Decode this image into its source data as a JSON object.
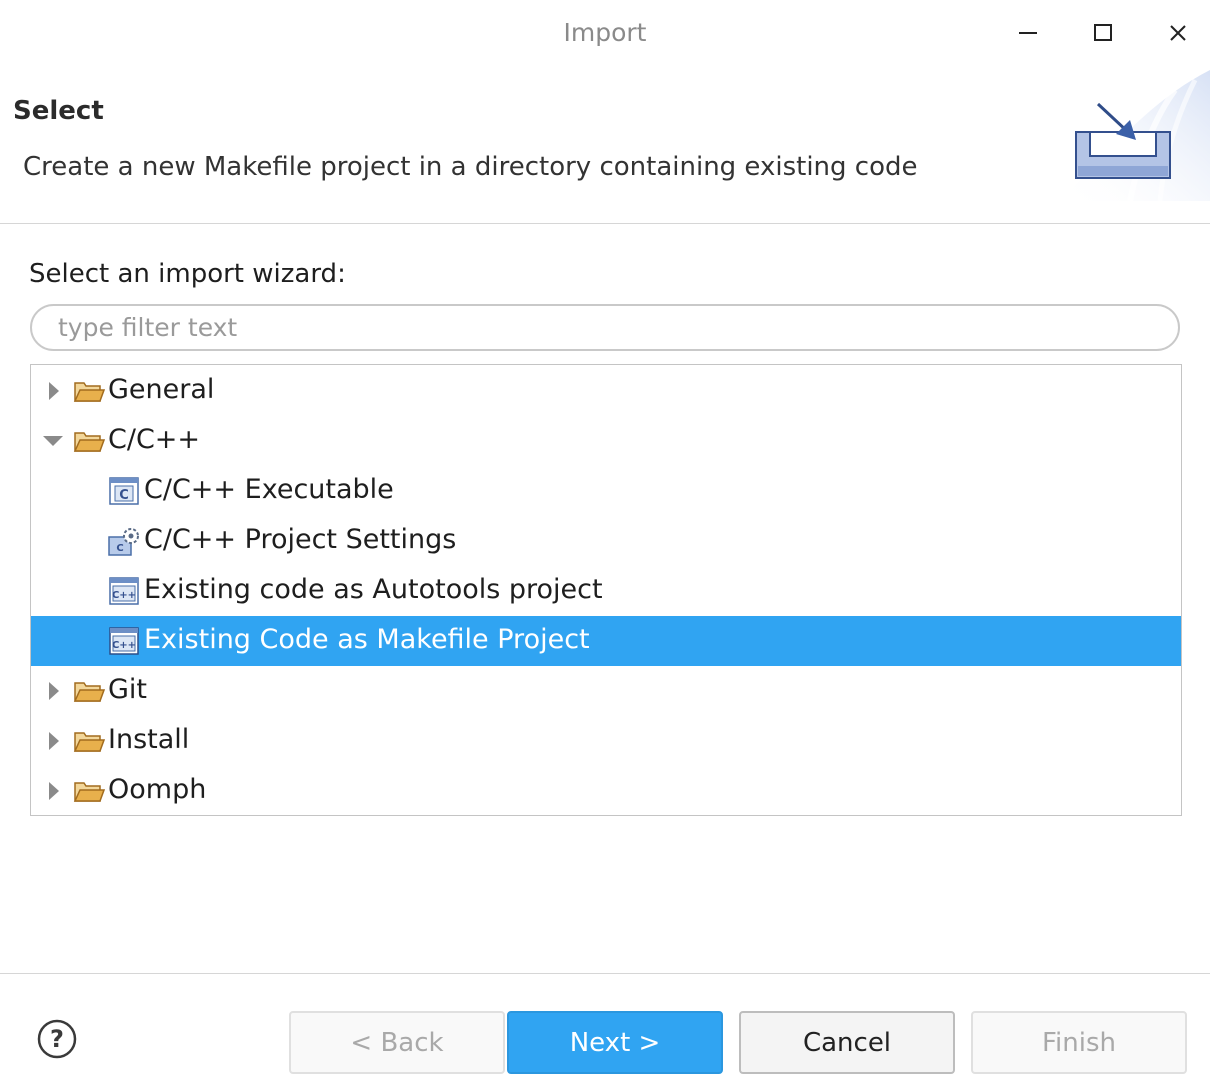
{
  "window": {
    "title": "Import",
    "controls": [
      "minimize-icon",
      "maximize-icon",
      "close-icon"
    ]
  },
  "header": {
    "title": "Select",
    "description": "Create a new Makefile project in a directory containing existing code",
    "banner_icon": "import-wizard-icon"
  },
  "main": {
    "wizard_label": "Select an import wizard:",
    "filter_placeholder": "type filter text",
    "filter_value": "",
    "tree": [
      {
        "label": "General",
        "expanded": false,
        "icon": "folder-icon"
      },
      {
        "label": "C/C++",
        "expanded": true,
        "icon": "folder-icon"
      },
      {
        "label": "C/C++ Executable",
        "icon": "c-file-icon"
      },
      {
        "label": "C/C++ Project Settings",
        "icon": "project-settings-icon"
      },
      {
        "label": "Existing code as Autotools project",
        "icon": "cpp-project-icon"
      },
      {
        "label": "Existing Code as Makefile Project",
        "icon": "cpp-project-icon",
        "selected": true
      },
      {
        "label": "Git",
        "expanded": false,
        "icon": "folder-icon"
      },
      {
        "label": "Install",
        "expanded": false,
        "icon": "folder-icon"
      },
      {
        "label": "Oomph",
        "expanded": false,
        "icon": "folder-icon"
      }
    ]
  },
  "footer": {
    "help_icon": "help-icon",
    "back_label": "< Back",
    "next_label": "Next >",
    "cancel_label": "Cancel",
    "finish_label": "Finish"
  },
  "colors": {
    "selection": "#30a4f2",
    "primary_button": "#30a4f2",
    "folder": "#e8b04c"
  }
}
